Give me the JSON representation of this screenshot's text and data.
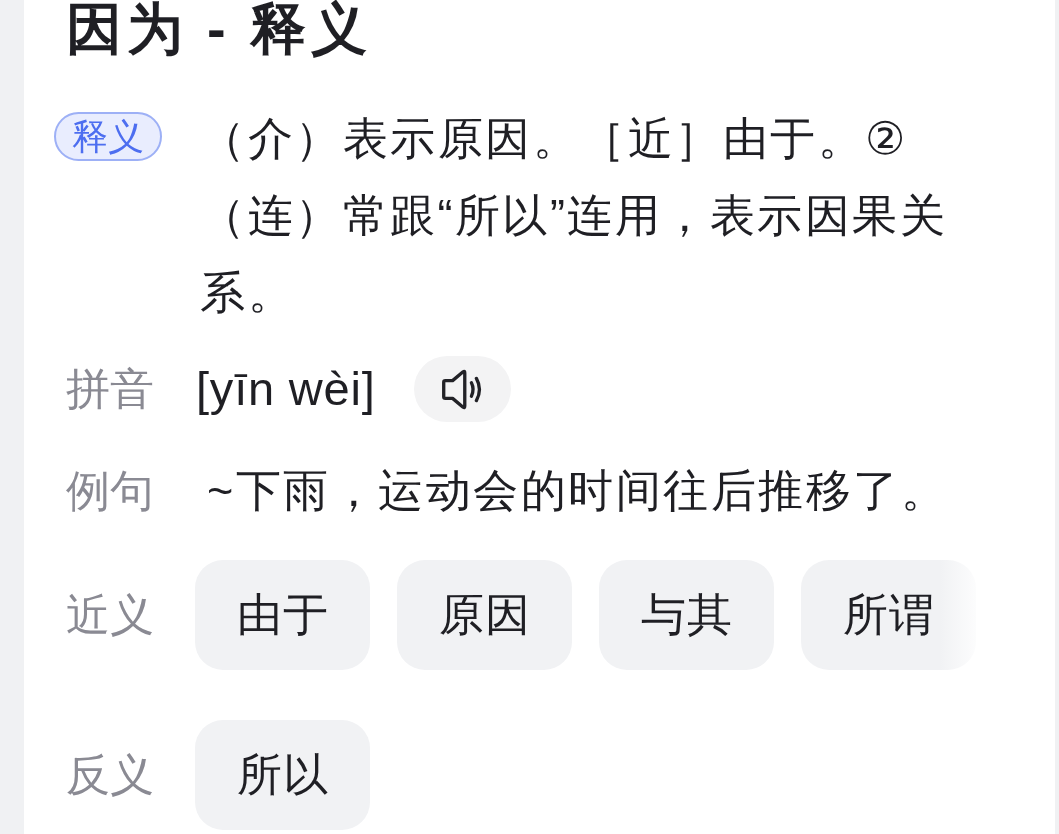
{
  "title": "因为 - 释义",
  "rows": [
    {
      "kind": "definition",
      "label": "释义",
      "text": "（介）表示原因。［近］由于。②（连）常跟“所以”连用，表示因果关系。"
    },
    {
      "kind": "pinyin",
      "label": "拼音",
      "text": "[yīn wèi]"
    },
    {
      "kind": "sentence",
      "label": "例句",
      "text": "~下雨，运动会的时间往后推移了。"
    },
    {
      "kind": "chips",
      "label": "近义",
      "items": [
        "由于",
        "原因",
        "与其",
        "所谓"
      ]
    },
    {
      "kind": "chips",
      "label": "反义",
      "items": [
        "所以"
      ]
    }
  ]
}
